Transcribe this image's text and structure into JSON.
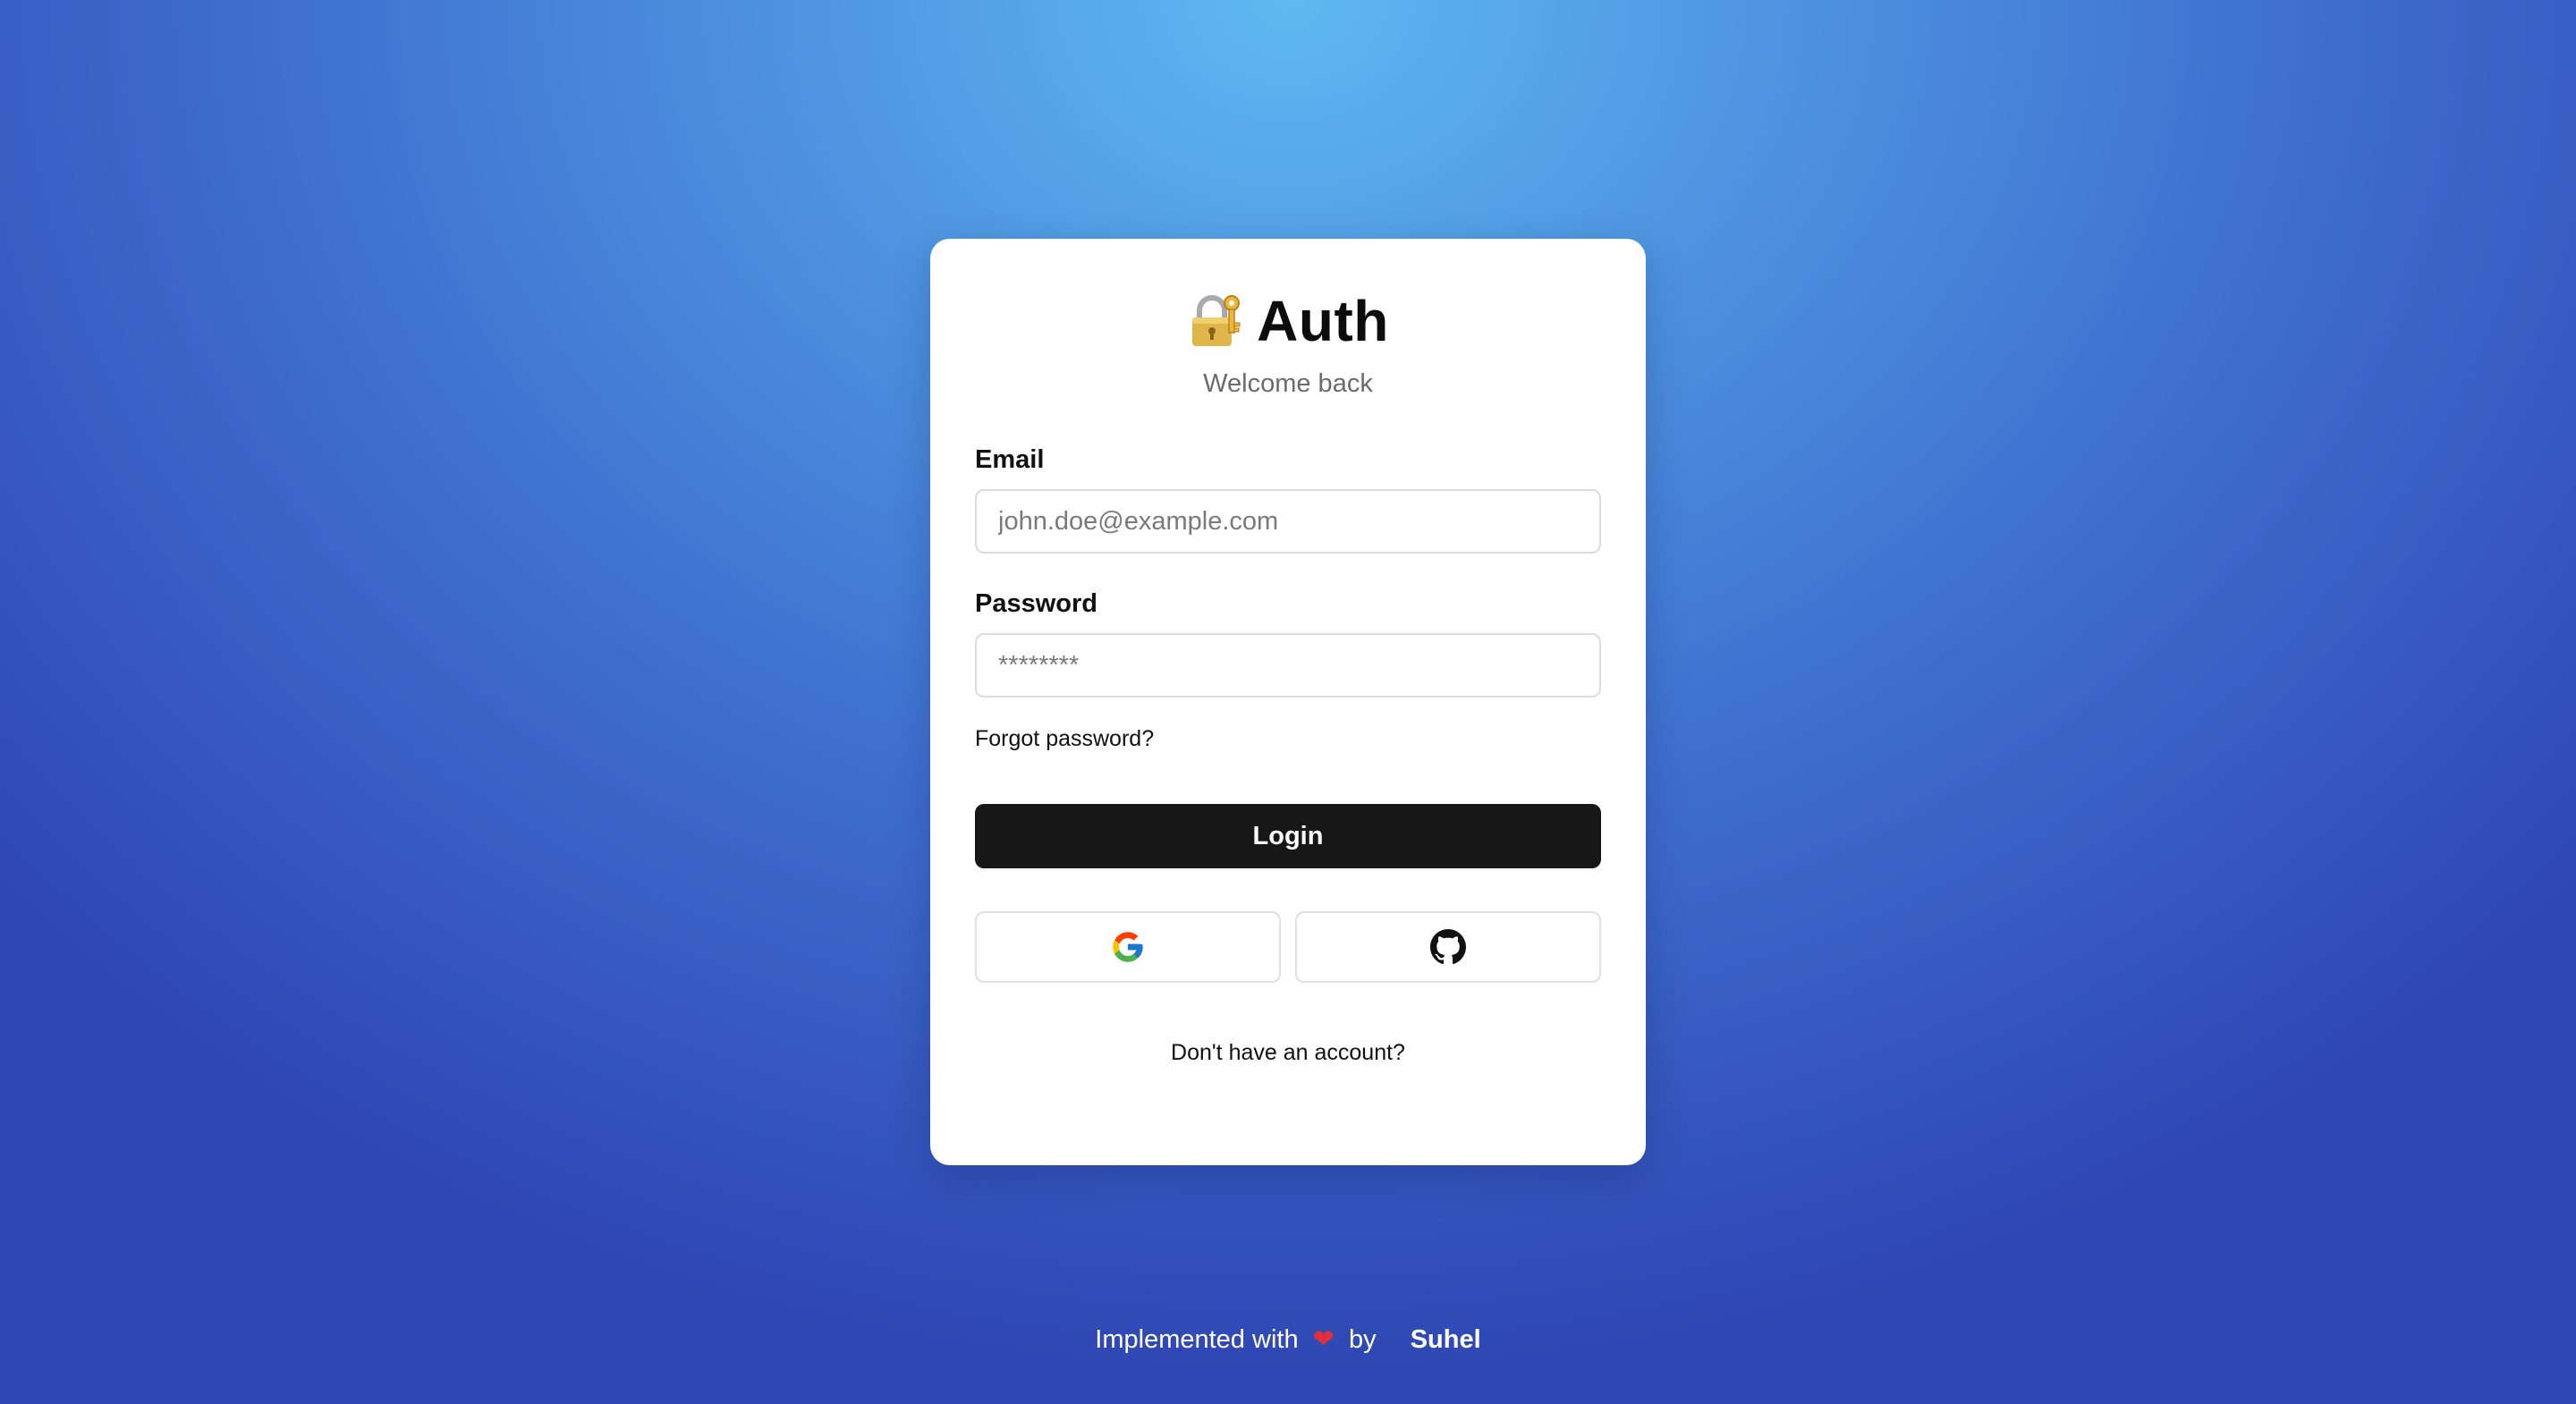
{
  "brand": {
    "icon": "lock-with-key-icon",
    "title": "Auth",
    "subtitle": "Welcome back"
  },
  "form": {
    "email": {
      "label": "Email",
      "placeholder": "john.doe@example.com",
      "value": ""
    },
    "password": {
      "label": "Password",
      "placeholder": "********",
      "value": ""
    },
    "forgot_link": "Forgot password?",
    "login_label": "Login"
  },
  "social": [
    {
      "icon": "google-icon"
    },
    {
      "icon": "github-icon"
    }
  ],
  "signup_link": "Don't have an account?",
  "footer": {
    "prefix": "Implemented with",
    "heart": "❤",
    "by": "by",
    "author": "Suhel"
  },
  "colors": {
    "button_bg": "#171717",
    "heart": "#e0303a",
    "gradient_light": "#60b8f2",
    "gradient_dark": "#2e46b3"
  }
}
